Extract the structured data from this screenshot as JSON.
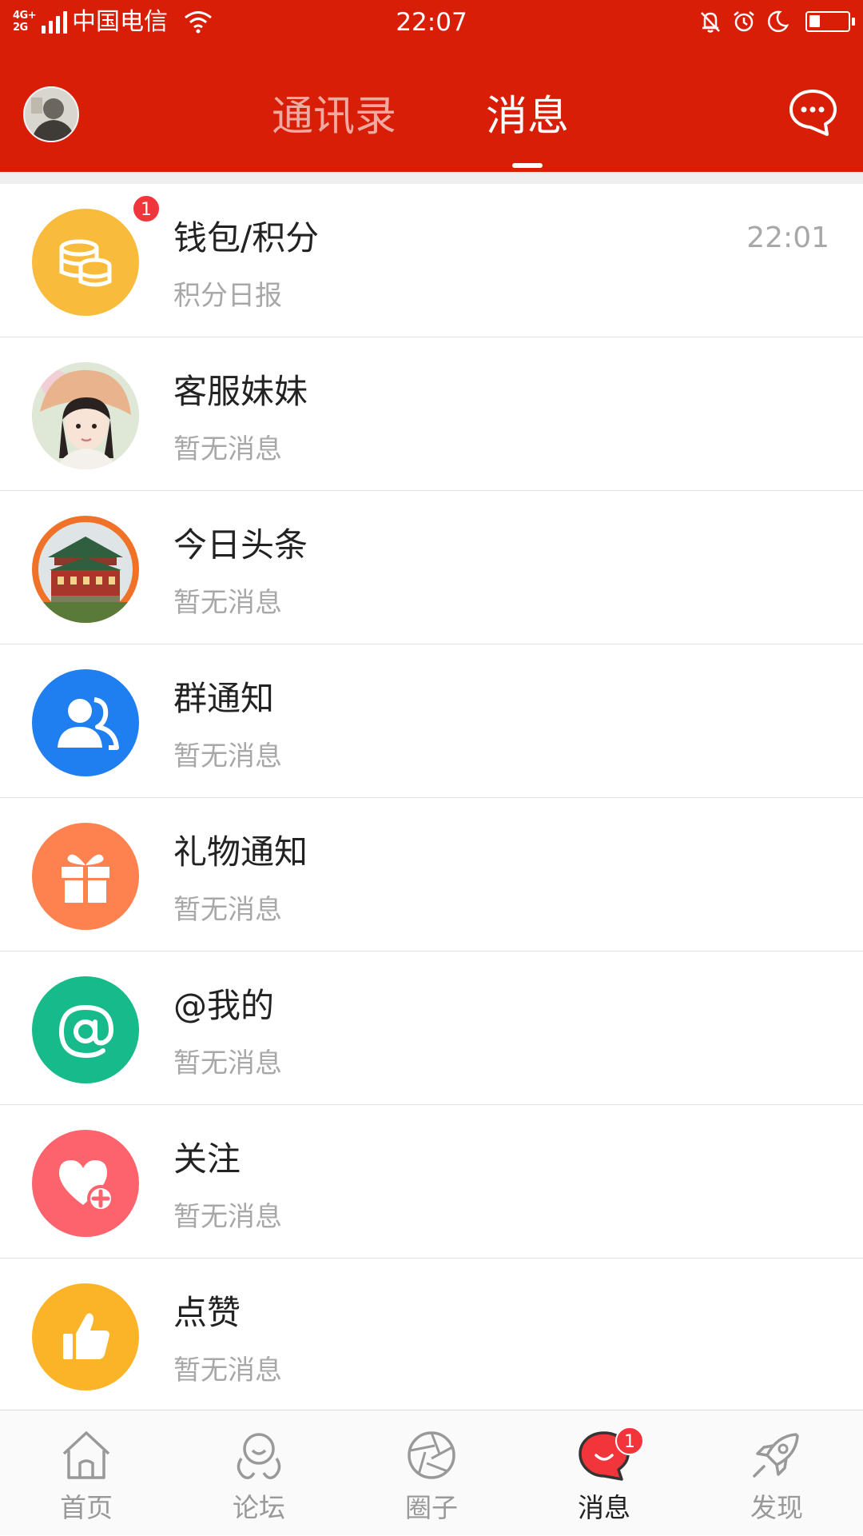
{
  "status_bar": {
    "network": "4G+ 2G",
    "carrier": "中国电信",
    "time": "22:07",
    "battery_level": 0.28
  },
  "header": {
    "tabs": [
      {
        "label": "通讯录",
        "active": false
      },
      {
        "label": "消息",
        "active": true
      }
    ],
    "avatar_icon": "user-avatar",
    "chat_icon": "chat-bubble-icon"
  },
  "messages": [
    {
      "title": "钱包/积分",
      "subtitle": "积分日报",
      "time": "22:01",
      "badge": "1",
      "icon": "coins-icon",
      "icon_color": "#f8bb3c"
    },
    {
      "title": "客服妹妹",
      "subtitle": "暂无消息",
      "icon": "service-avatar",
      "icon_color": "#e8ddd0"
    },
    {
      "title": "今日头条",
      "subtitle": "暂无消息",
      "icon": "building-avatar",
      "icon_color": "#f07128"
    },
    {
      "title": "群通知",
      "subtitle": "暂无消息",
      "icon": "group-icon",
      "icon_color": "#1f7ef0"
    },
    {
      "title": "礼物通知",
      "subtitle": "暂无消息",
      "icon": "gift-icon",
      "icon_color": "#fe8250"
    },
    {
      "title": "@我的",
      "subtitle": "暂无消息",
      "icon": "at-icon",
      "icon_color": "#17ba8a"
    },
    {
      "title": "关注",
      "subtitle": "暂无消息",
      "icon": "heart-plus-icon",
      "icon_color": "#fd636c"
    },
    {
      "title": "点赞",
      "subtitle": "暂无消息",
      "icon": "thumbs-up-icon",
      "icon_color": "#fbb428"
    }
  ],
  "bottom_nav": [
    {
      "label": "首页",
      "icon": "home-icon",
      "active": false
    },
    {
      "label": "论坛",
      "icon": "forum-icon",
      "active": false
    },
    {
      "label": "圈子",
      "icon": "aperture-icon",
      "active": false
    },
    {
      "label": "消息",
      "icon": "message-icon",
      "active": true,
      "badge": "1"
    },
    {
      "label": "发现",
      "icon": "rocket-icon",
      "active": false
    }
  ],
  "colors": {
    "brand_red": "#d81e06",
    "badge_red": "#f2353b",
    "muted_text": "#a8a8a8"
  }
}
